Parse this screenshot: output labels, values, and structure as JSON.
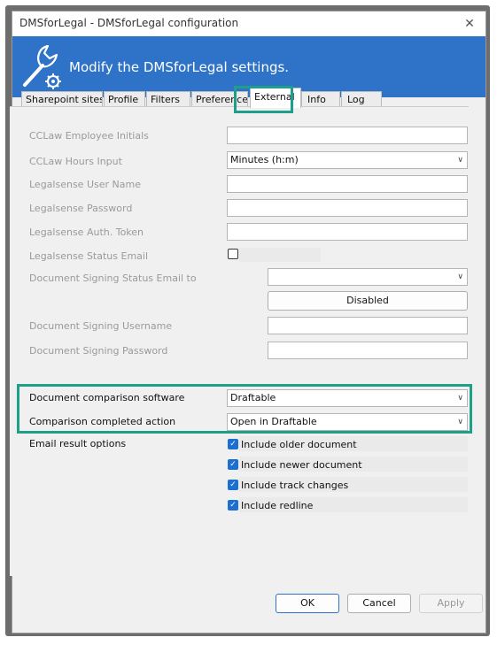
{
  "window": {
    "title": "DMSforLegal - DMSforLegal configuration",
    "close": "✕"
  },
  "banner": {
    "text": "Modify the DMSforLegal settings."
  },
  "tabs": [
    "Sharepoint sites",
    "Profile",
    "Filters",
    "Preferences",
    "External",
    "Info",
    "Log"
  ],
  "form": {
    "cclaw_initials_label": "CCLaw Employee Initials",
    "cclaw_initials_value": "",
    "cclaw_hours_label": "CCLaw Hours Input",
    "cclaw_hours_value": "Minutes  (h:m)",
    "legalsense_user_label": "Legalsense User Name",
    "legalsense_user_value": "",
    "legalsense_password_label": "Legalsense Password",
    "legalsense_password_value": "",
    "legalsense_token_label": "Legalsense Auth. Token",
    "legalsense_token_value": "",
    "legalsense_status_label": "Legalsense Status Email",
    "legalsense_status_checked": false,
    "signing_email_label": "Document Signing Status Email to",
    "signing_email_value": "",
    "disabled_button": "Disabled",
    "signing_username_label": "Document Signing Username",
    "signing_username_value": "",
    "signing_password_label": "Document Signing Password",
    "signing_password_value": "",
    "comparison_software_label": "Document comparison software",
    "comparison_software_value": "Draftable",
    "comparison_action_label": "Comparison completed action",
    "comparison_action_value": "Open in Draftable",
    "email_options_label": "Email result options",
    "email_options": [
      {
        "label": "Include older document",
        "checked": true
      },
      {
        "label": "Include newer document",
        "checked": true
      },
      {
        "label": "Include track changes",
        "checked": true
      },
      {
        "label": "Include redline",
        "checked": true
      }
    ]
  },
  "buttons": {
    "ok": "OK",
    "cancel": "Cancel",
    "apply": "Apply"
  },
  "colors": {
    "banner": "#2f73c8",
    "highlight": "#1f9f89",
    "checkbox": "#1a6fd1"
  },
  "icons": {
    "banner": "wrench-gear-icon",
    "dropdown": "chevron-down-icon",
    "check": "checkmark-icon"
  }
}
